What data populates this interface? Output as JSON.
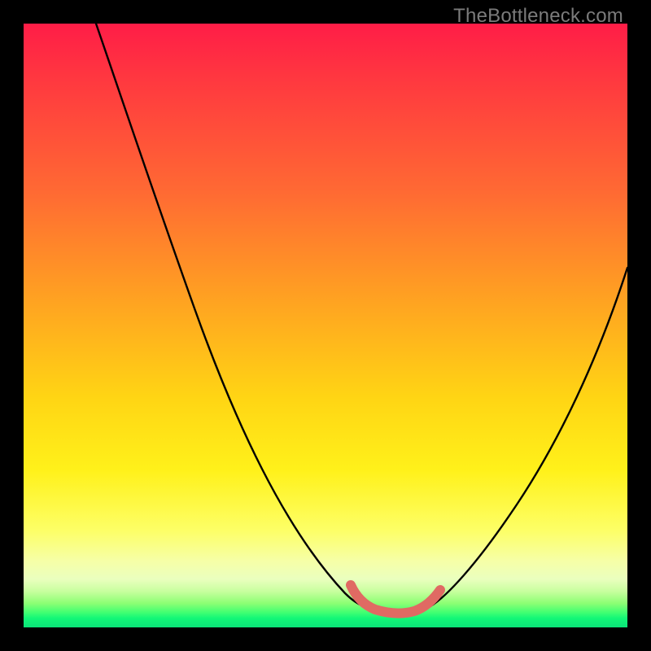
{
  "watermark": "TheBottleneck.com",
  "colors": {
    "background": "#000000",
    "curve": "#000000",
    "accent_arc": "#e06a63",
    "gradient_top": "#ff1d47",
    "gradient_bottom": "#0be378"
  },
  "chart_data": {
    "type": "line",
    "title": "",
    "xlabel": "",
    "ylabel": "",
    "xlim": [
      0,
      100
    ],
    "ylim": [
      0,
      100
    ],
    "grid": false,
    "legend": false,
    "note": "Bottleneck-style V curve. x is an abstract component-balance axis (0–100), y is mismatch percentage (0 at green bottom, 100 at red top). Values are estimated from the rendered curve.",
    "series": [
      {
        "name": "left-branch",
        "x": [
          12,
          16,
          20,
          24,
          28,
          32,
          36,
          40,
          44,
          48,
          52,
          55,
          57
        ],
        "values": [
          100,
          92,
          83,
          74,
          65,
          56,
          47,
          38,
          30,
          22,
          14,
          9,
          6
        ]
      },
      {
        "name": "right-branch",
        "x": [
          67,
          70,
          74,
          78,
          82,
          86,
          90,
          94,
          98,
          100
        ],
        "values": [
          6,
          10,
          16,
          23,
          30,
          37,
          44,
          51,
          58,
          61
        ]
      },
      {
        "name": "trough-accent",
        "x": [
          55,
          57,
          59,
          61,
          63,
          65,
          67
        ],
        "values": [
          9,
          6,
          4.5,
          4,
          4.5,
          6,
          9
        ]
      }
    ]
  }
}
